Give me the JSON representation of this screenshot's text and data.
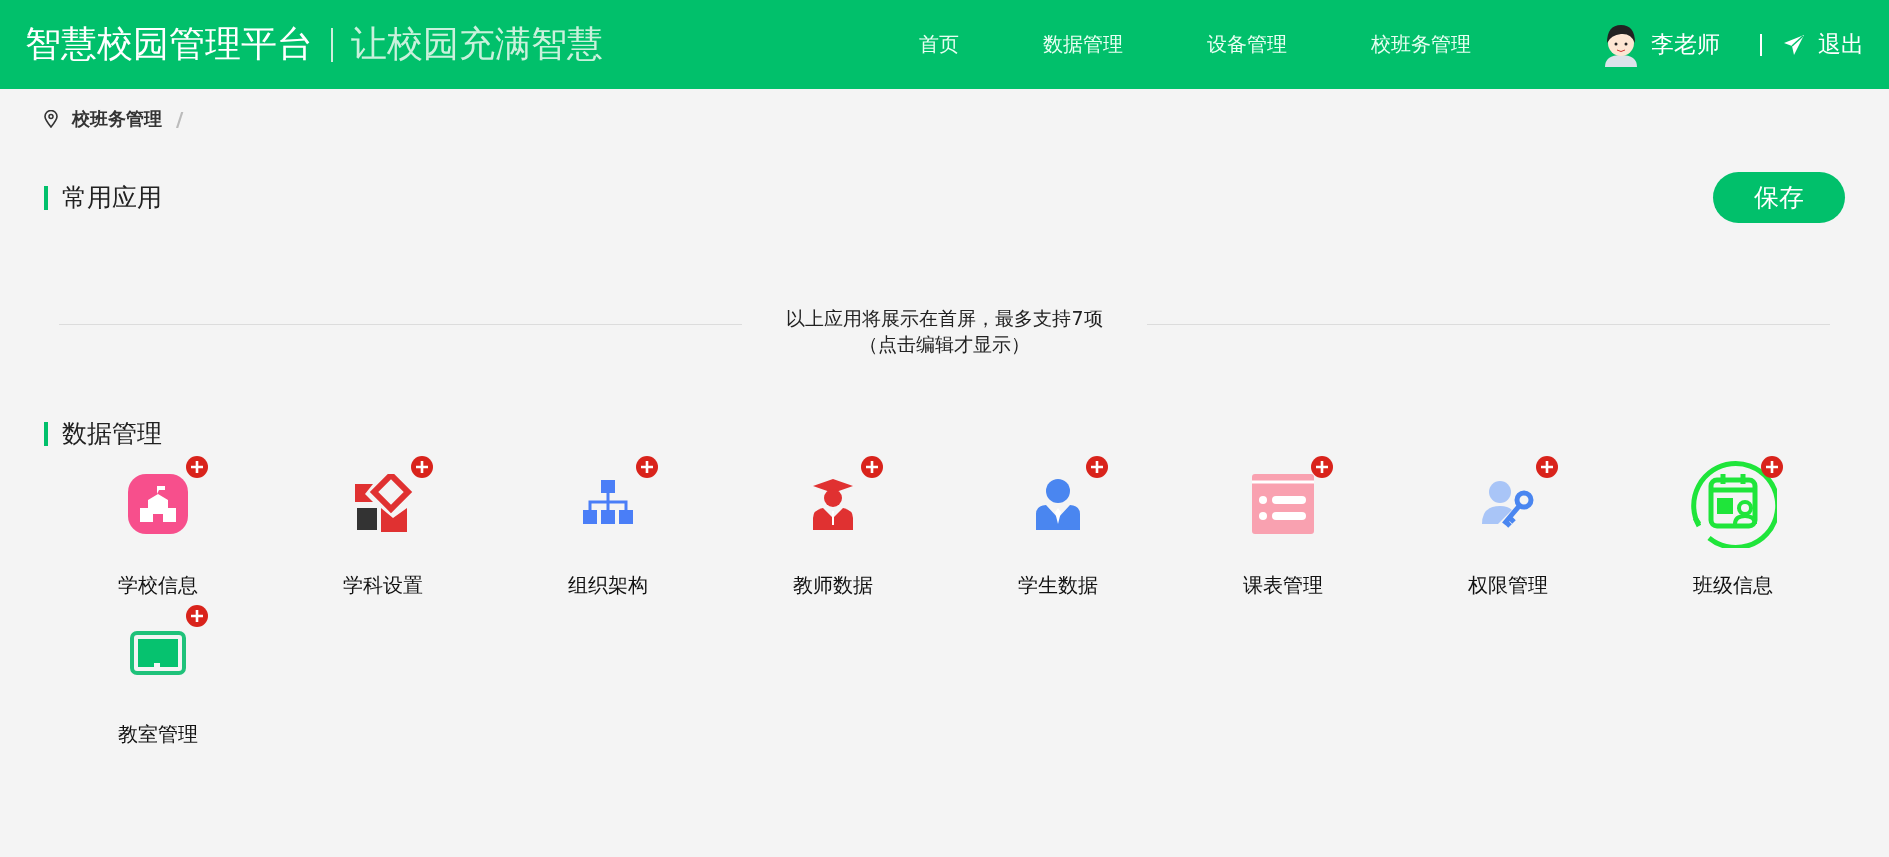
{
  "header": {
    "title": "智慧校园管理平台",
    "slogan": "让校园充满智慧",
    "nav": [
      {
        "label": "首页",
        "selected": false
      },
      {
        "label": "数据管理",
        "selected": false
      },
      {
        "label": "设备管理",
        "selected": false
      },
      {
        "label": "校班务管理",
        "selected": false
      }
    ],
    "user": "李老师",
    "logout": "退出"
  },
  "breadcrumb": {
    "items": [
      "校班务管理"
    ],
    "separator": "/"
  },
  "common_apps": {
    "title": "常用应用",
    "save": "保存",
    "hint_lines": [
      "以上应用将展示在首屏，最多支持7项",
      "（点击编辑才显示）"
    ]
  },
  "data_management": {
    "title": "数据管理",
    "apps": [
      {
        "label": "学校信息"
      },
      {
        "label": "学科设置"
      },
      {
        "label": "组织架构"
      },
      {
        "label": "教师数据"
      },
      {
        "label": "学生数据"
      },
      {
        "label": "课表管理"
      },
      {
        "label": "权限管理"
      },
      {
        "label": "班级信息"
      },
      {
        "label": "教室管理"
      }
    ]
  }
}
